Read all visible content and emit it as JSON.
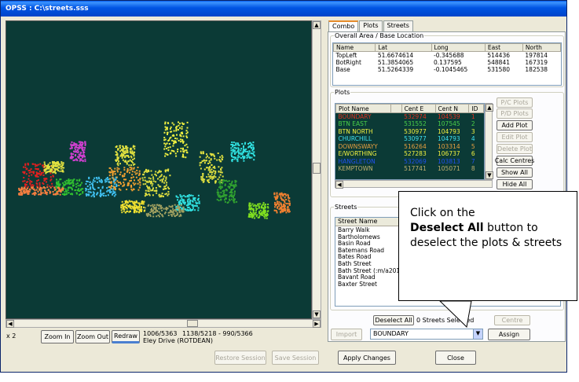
{
  "window": {
    "title": "OPSS : C:\\streets.sss"
  },
  "map_toolbar": {
    "scale_label": "x 2",
    "zoom_in": "Zoom In",
    "zoom_out": "Zoom Out",
    "redraw": "Redraw",
    "coords_a": "1006/5363",
    "coords_b": "1138/5218 - 990/5366",
    "location": "Eley Drive (ROTDEAN)"
  },
  "tabs": [
    "Combo",
    "Plots",
    "Streets"
  ],
  "overall_area": {
    "title": "Overall Area / Base Location",
    "columns": [
      "Name",
      "Lat",
      "Long",
      "East",
      "North"
    ],
    "rows": [
      [
        "TopLeft",
        "51.6674614",
        "-0.345688",
        "514436",
        "197814"
      ],
      [
        "BotRight",
        "51.3854065",
        "0.137595",
        "548841",
        "167319"
      ],
      [
        "Base",
        "51.5264339",
        "-0.1045465",
        "531580",
        "182538"
      ]
    ]
  },
  "plots": {
    "title": "Plots",
    "columns": [
      "Plot Name",
      "",
      "Cent E",
      "Cent N",
      "ID"
    ],
    "rows": [
      {
        "name": "BOUNDARY",
        "cent_e": "532974",
        "cent_n": "104539",
        "id": "1",
        "color": "#e03020"
      },
      {
        "name": "BTN EAST",
        "cent_e": "531552",
        "cent_n": "107545",
        "id": "2",
        "color": "#4ad04a"
      },
      {
        "name": "BTN NORTH",
        "cent_e": "530977",
        "cent_n": "104793",
        "id": "3",
        "color": "#f0f040"
      },
      {
        "name": "CHURCHILL",
        "cent_e": "530977",
        "cent_n": "104793",
        "id": "4",
        "color": "#40e0f0"
      },
      {
        "name": "DOWNSWAYY",
        "cent_e": "516264",
        "cent_n": "103314",
        "id": "5",
        "color": "#e8a040"
      },
      {
        "name": "E/WORTHING",
        "cent_e": "527283",
        "cent_n": "106737",
        "id": "6",
        "color": "#f0f040"
      },
      {
        "name": "HANGLETON",
        "cent_e": "532069",
        "cent_n": "103813",
        "id": "7",
        "color": "#2050f0"
      },
      {
        "name": "KEMPTOWN",
        "cent_e": "517741",
        "cent_n": "105071",
        "id": "8",
        "color": "#c0b070"
      }
    ],
    "buttons": {
      "pc_plots": "P/C Plots",
      "pd_plots": "P/D Plots",
      "add_plot": "Add Plot",
      "edit_plot": "Edit Plot",
      "delete_plot": "Delete Plot",
      "calc_centres": "Calc Centres",
      "show_all": "Show All",
      "hide_all": "Hide All"
    }
  },
  "streets": {
    "title": "Streets",
    "column": "Street Name",
    "items": [
      "Barry Walk",
      "Bartholomews",
      "Basin Road",
      "Batemans Road",
      "Bates Road",
      "Bath Street",
      "Bath Street (:m/a201",
      "Bavant Road",
      "Baxter Street"
    ]
  },
  "bottom": {
    "deselect_all": "Deselect All",
    "selected_count": "0 Streets Selected",
    "centre": "Centre",
    "import": "Import",
    "plot_combo": "BOUNDARY",
    "assign": "Assign",
    "restore_session": "Restore Session",
    "save_session": "Save Session",
    "apply_changes": "Apply Changes",
    "close": "Close"
  },
  "callout": {
    "prefix": "Click on the",
    "bold": "Deselect All",
    "suffix": "button to deselect the plots & streets"
  }
}
